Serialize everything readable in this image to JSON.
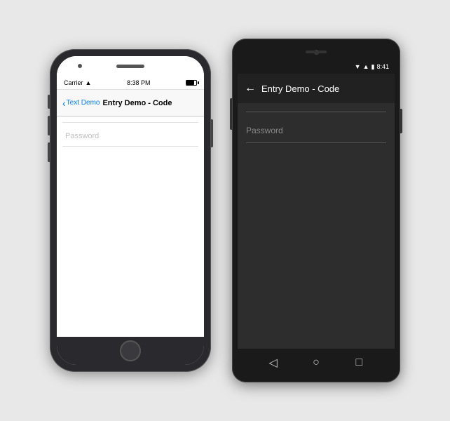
{
  "ios": {
    "status": {
      "carrier": "Carrier",
      "wifi_icon": "▲",
      "time": "8:38 PM"
    },
    "nav": {
      "back_link": "Text Demo",
      "title": "Entry Demo - Code"
    },
    "content": {
      "password_placeholder": "Password"
    }
  },
  "android": {
    "status": {
      "wifi_icon": "▼",
      "signal_icon": "▲",
      "battery_icon": "▮",
      "time": "8:41"
    },
    "nav": {
      "back_arrow": "←",
      "title": "Entry Demo - Code"
    },
    "content": {
      "password_placeholder": "Password"
    },
    "bottom_nav": {
      "back": "◁",
      "home": "○",
      "recent": "□"
    }
  }
}
